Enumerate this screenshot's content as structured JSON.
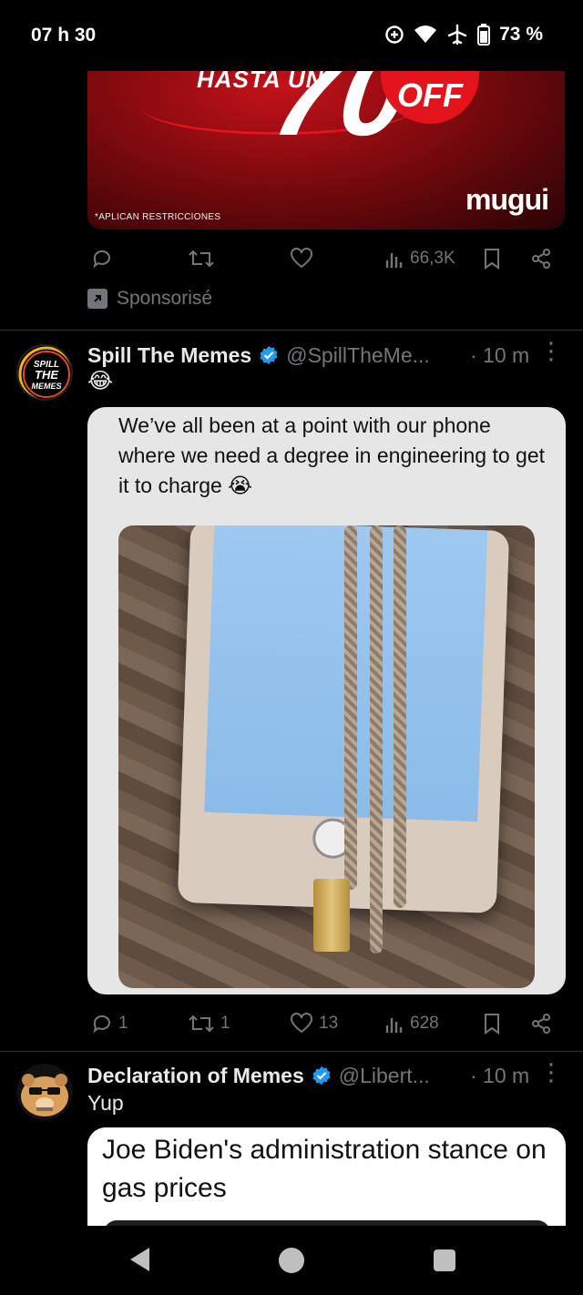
{
  "status_bar": {
    "time": "07 h 30",
    "battery_percent": "73 %",
    "icons": [
      "data-saver-icon",
      "wifi-icon",
      "airplane-icon",
      "battery-icon"
    ]
  },
  "ad": {
    "headline_partial": "HASTA UN",
    "big_number_partial": "70",
    "off_label": "OFF",
    "disclaimer": "*APLICAN RESTRICCIONES",
    "brand": "mugui",
    "actions": {
      "views": "66,3K"
    },
    "sponsored_label": "Sponsorisé"
  },
  "tweets": [
    {
      "author": "Spill The Memes",
      "handle": "@SpillTheMe...",
      "time": "· 10 m",
      "emoji": "😂",
      "quoted_text": "We’ve all been at a point with our phone where we need a degree in engineering to get it to charge 😭",
      "avatar_text": "SPILL THE MEMES",
      "actions": {
        "replies": "1",
        "retweets": "1",
        "likes": "13",
        "views": "628"
      }
    },
    {
      "author": "Declaration of Memes",
      "handle": "@Libert...",
      "time": "· 10 m",
      "text": "Yup",
      "quoted_text": "Joe Biden's administration stance on gas prices"
    }
  ],
  "colors": {
    "background": "#000000",
    "muted": "#71767b",
    "verified": "#1d9bf0",
    "text": "#e7e9ea"
  }
}
